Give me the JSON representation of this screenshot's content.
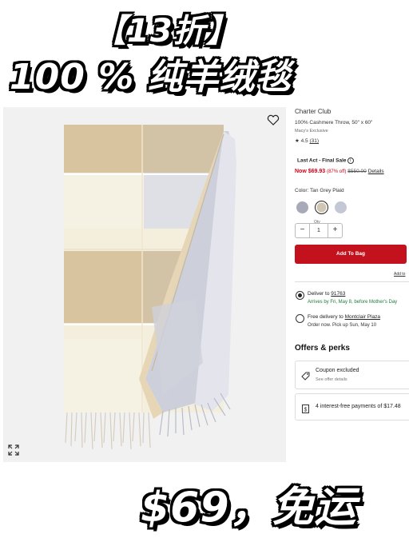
{
  "banner": {
    "line1": "【13折】",
    "line2": "100 % 纯羊绒毯",
    "line3": "$69，免运"
  },
  "product": {
    "brand": "Charter Club",
    "name": "100% Cashmere Throw, 50\" x 60\"",
    "exclusive": "Macy's Exclusive",
    "rating": "4.5",
    "reviews": "(31)",
    "badge": "Last Act - Final Sale",
    "price_now": "Now $69.93",
    "price_pct": "(87% off)",
    "price_was": "$550.00",
    "details_link": "Details",
    "color_label": "Color: Tan Grey Plaid",
    "swatches": [
      "#a9aab8",
      "#cfc7b2",
      "#c3c8d4"
    ],
    "qty_label": "Qty",
    "qty_value": "1",
    "qty_minus": "−",
    "qty_plus": "+",
    "add_to_bag": "Add To Bag",
    "add_to_list": "Add to"
  },
  "delivery": {
    "opt1_label": "Deliver to",
    "opt1_zip": "91763",
    "opt1_eta": "Arrives by Fri, May 8, before Mother's Day",
    "opt2_label": "Free delivery to",
    "opt2_store": "Montclair Plaza",
    "opt2_eta": "Order now. Pick up Sun, May 10"
  },
  "offers": {
    "title": "Offers & perks",
    "coupon_title": "Coupon excluded",
    "coupon_sub": "See offer details",
    "installments": "4 interest-free payments of $17.48"
  },
  "colors": {
    "accent_red": "#c4111e",
    "sale_red": "#d0021b",
    "green": "#1d7a3a",
    "tan": "#d9c4a0",
    "grey": "#cdd0da",
    "cream": "#f3efdc"
  }
}
